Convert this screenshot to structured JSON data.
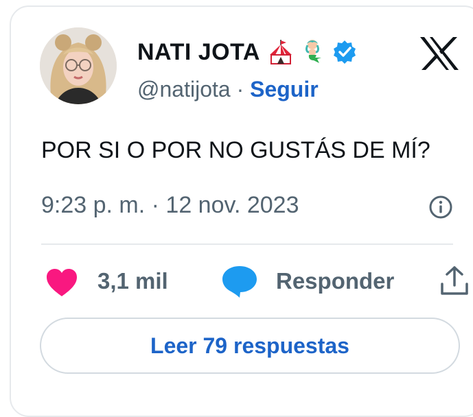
{
  "author": {
    "display_name": "NATI JOTA",
    "handle": "@natijota",
    "separator": " · ",
    "follow_label": "Seguir",
    "verified": true
  },
  "tweet": {
    "text": "POR SI O POR NO GUSTÁS DE MÍ?",
    "timestamp": "9:23 p. m. · 12 nov. 2023"
  },
  "actions": {
    "like_count": "3,1 mil",
    "reply_label": "Responder"
  },
  "footer": {
    "read_replies_label": "Leer 79 respuestas"
  },
  "icons": {
    "brand": "x-logo-icon",
    "verified": "verified-badge-icon",
    "emoji_1": "circus-tent-icon",
    "emoji_2": "mermaid-icon",
    "info": "info-icon",
    "like": "heart-icon",
    "reply": "speech-bubble-icon",
    "share": "share-icon"
  },
  "colors": {
    "like": "#f91880",
    "reply": "#1d9bf0",
    "link": "#1d64c8",
    "verified": "#1d9bf0",
    "muted_text": "#536471",
    "text": "#0f1419",
    "border": "#e6e9ec"
  }
}
